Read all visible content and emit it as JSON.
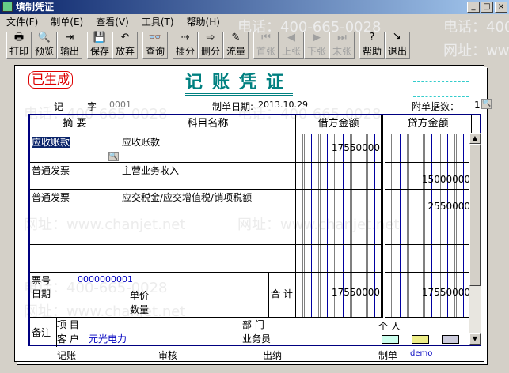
{
  "window": {
    "title": "填制凭证",
    "min": "_",
    "max": "□",
    "close": "×"
  },
  "menu": [
    "文件(F)",
    "制单(E)",
    "查看(V)",
    "工具(T)",
    "帮助(H)"
  ],
  "toolbar": [
    {
      "label": "打印",
      "icon": "🖶",
      "enabled": true
    },
    {
      "label": "预览",
      "icon": "🔍",
      "enabled": true
    },
    {
      "label": "输出",
      "icon": "⇥",
      "enabled": true
    },
    {
      "label": "保存",
      "icon": "💾",
      "enabled": true
    },
    {
      "label": "放弃",
      "icon": "↶",
      "enabled": true
    },
    {
      "label": "查询",
      "icon": "👓",
      "enabled": true
    },
    {
      "label": "插分",
      "icon": "⇢",
      "enabled": true
    },
    {
      "label": "删分",
      "icon": "⇨",
      "enabled": true
    },
    {
      "label": "流量",
      "icon": "✎",
      "enabled": true
    },
    {
      "label": "首张",
      "icon": "⏮",
      "enabled": false
    },
    {
      "label": "上张",
      "icon": "◀",
      "enabled": false
    },
    {
      "label": "下张",
      "icon": "▶",
      "enabled": false
    },
    {
      "label": "末张",
      "icon": "⏭",
      "enabled": false
    },
    {
      "label": "帮助",
      "icon": "?",
      "enabled": true
    },
    {
      "label": "退出",
      "icon": "⇲",
      "enabled": true
    }
  ],
  "watermark": {
    "phone": "电话：400-665-0028",
    "site": "网址：www.chanjet.net"
  },
  "voucher": {
    "stamp": "已生成",
    "title": "记账凭证",
    "type": "记",
    "type_suffix": "字",
    "number": "0001",
    "date_label": "制单日期:",
    "date": "2013.10.29",
    "attach_label": "附单据数：",
    "attach": "1",
    "headers": {
      "summary": "摘 要",
      "account": "科目名称",
      "debit": "借方金额",
      "credit": "贷方金额"
    },
    "rows": [
      {
        "summary": "应收账款",
        "account": "应收账款",
        "debit": "17550000",
        "credit": ""
      },
      {
        "summary": "普通发票",
        "account": "主营业务收入",
        "debit": "",
        "credit": "15000000"
      },
      {
        "summary": "普通发票",
        "account": "应交税金/应交增值税/销项税额",
        "debit": "",
        "credit": "2550000"
      },
      {
        "summary": "",
        "account": "",
        "debit": "",
        "credit": ""
      },
      {
        "summary": "",
        "account": "",
        "debit": "",
        "credit": ""
      }
    ],
    "ticket_label": "票号",
    "ticket": "0000000001",
    "date2_label": "日期",
    "price_label": "单价",
    "qty_label": "数量",
    "total_label": "合 计",
    "total_debit": "17550000",
    "total_credit": "17550000",
    "notes_label": "备注",
    "project_label": "项  目",
    "dept_label": "部  门",
    "person_label": "个  人",
    "customer_label": "客  户",
    "customer": "元光电力",
    "salesman_label": "业务员",
    "posting_label": "记账",
    "audit_label": "审核",
    "cashier_label": "出纳",
    "maker_label": "制单",
    "maker": "demo"
  }
}
